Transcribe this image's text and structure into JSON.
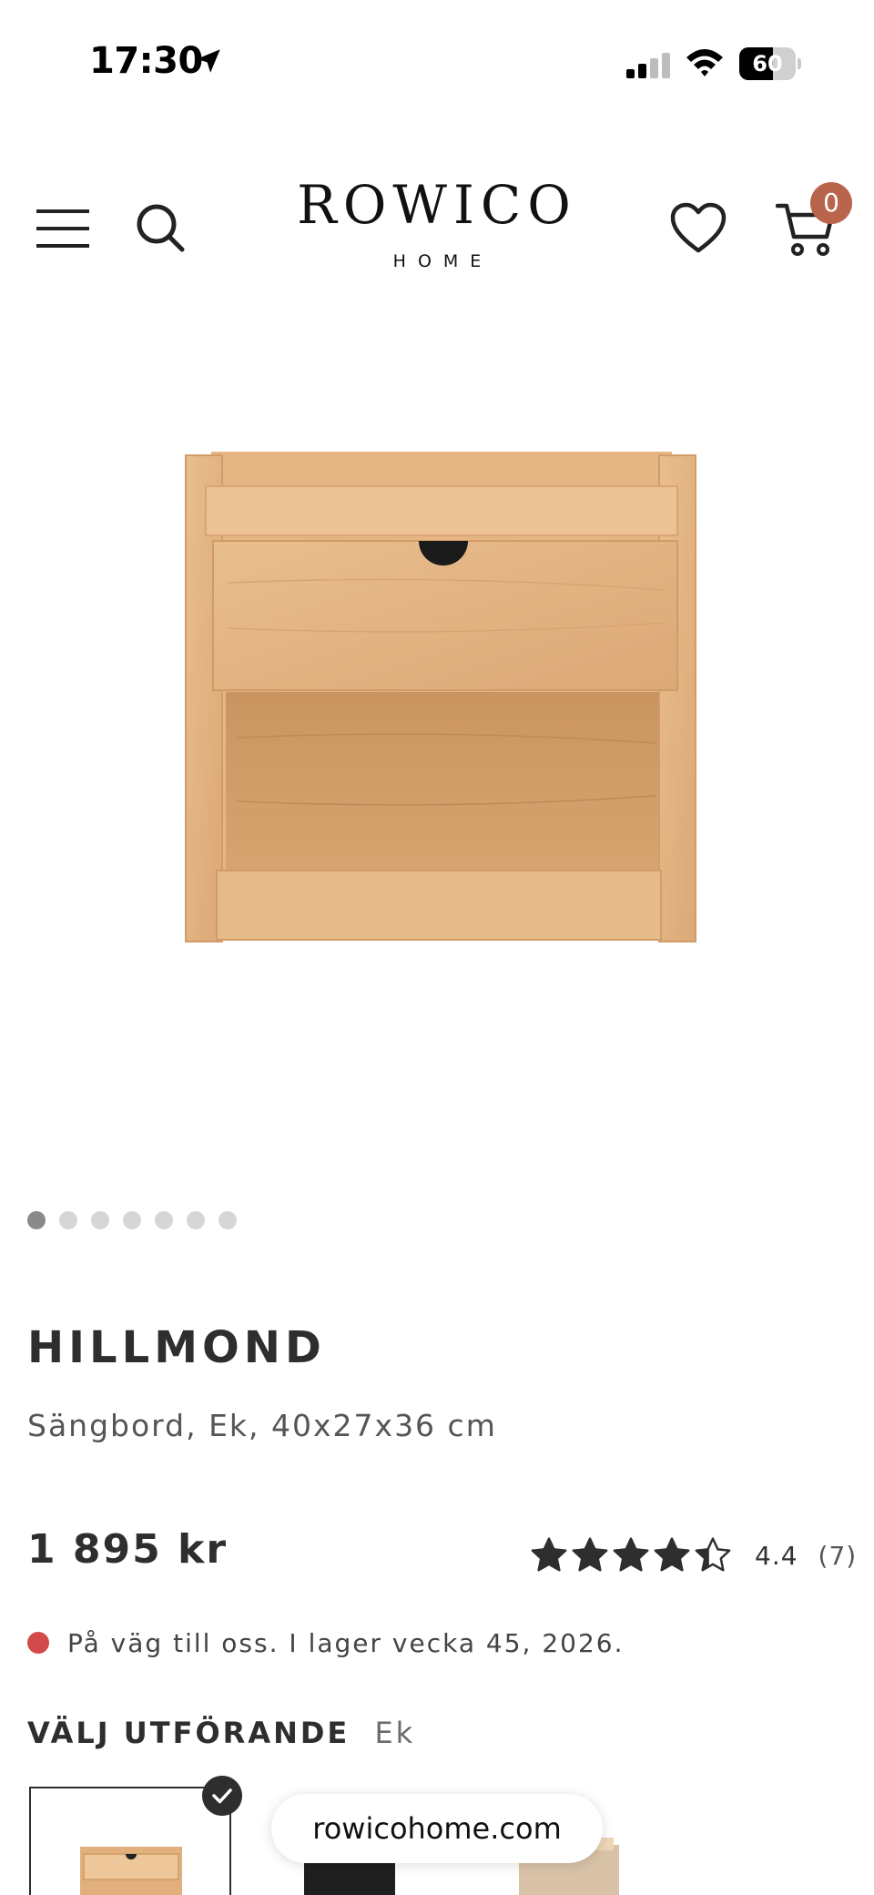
{
  "status_bar": {
    "time": "17:30",
    "battery_percent": 60,
    "battery_label": "60",
    "icons": [
      "location-arrow-icon",
      "cellular-signal-icon",
      "wifi-icon",
      "battery-icon"
    ]
  },
  "header": {
    "logo_main": "ROWICO",
    "logo_sub": "HOME",
    "cart_count": "0",
    "icons": [
      "hamburger-menu-icon",
      "search-icon",
      "heart-icon",
      "cart-icon"
    ],
    "badge_color": "#b8654c"
  },
  "carousel": {
    "total_images": 7,
    "active_index": 0
  },
  "product": {
    "title": "HILLMOND",
    "subtitle": "Sängbord, Ek, 40x27x36 cm",
    "price": "1 895 kr",
    "rating": {
      "value": 4.4,
      "value_label": "4.4",
      "max": 5,
      "count_label": "(7)"
    },
    "stock_text": "På väg till oss. I lager vecka 45, 2026.",
    "stock_status_color": "#d24a4a"
  },
  "variant": {
    "heading": "VÄLJ UTFÖRANDE",
    "selected_value": "Ek",
    "options": [
      {
        "finish": "oak",
        "selected": true
      },
      {
        "finish": "black",
        "selected": false
      },
      {
        "finish": "light",
        "selected": false
      }
    ]
  },
  "browser": {
    "url": "rowicohome.com"
  }
}
